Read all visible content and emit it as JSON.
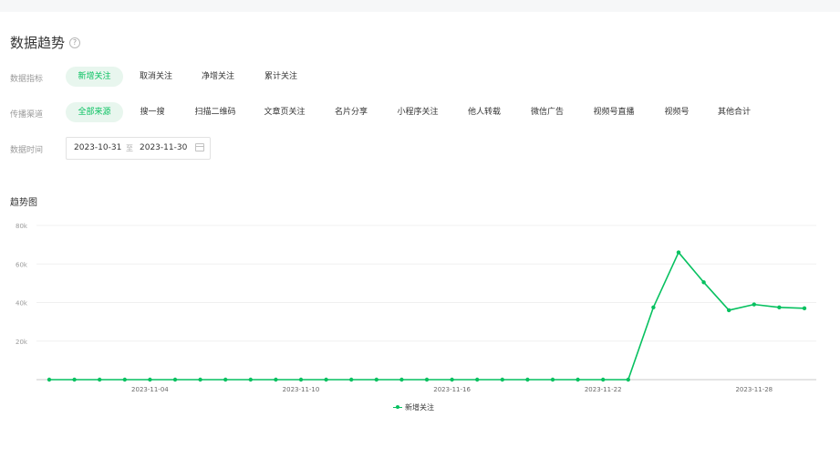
{
  "page": {
    "title": "数据趋势",
    "help_icon": "question-circle-icon"
  },
  "metric_row": {
    "label": "数据指标",
    "options": [
      "新增关注",
      "取消关注",
      "净增关注",
      "累计关注"
    ],
    "selected": "新增关注"
  },
  "source_row": {
    "label": "传播渠道",
    "options": [
      "全部来源",
      "搜一搜",
      "扫描二维码",
      "文章页关注",
      "名片分享",
      "小程序关注",
      "他人转载",
      "微信广告",
      "视频号直播",
      "视频号",
      "其他合计"
    ],
    "selected": "全部来源"
  },
  "time_row": {
    "label": "数据时间",
    "start": "2023-10-31",
    "separator": "至",
    "end": "2023-11-30",
    "icon": "calendar-icon"
  },
  "trend": {
    "title": "趋势图"
  },
  "colors": {
    "accent": "#07c160",
    "accent_bg": "#e8f6ee"
  },
  "chart_data": {
    "type": "line",
    "x": [
      "2023-11-01",
      "2023-11-02",
      "2023-11-03",
      "2023-11-04",
      "2023-11-05",
      "2023-11-06",
      "2023-11-07",
      "2023-11-08",
      "2023-11-09",
      "2023-11-10",
      "2023-11-11",
      "2023-11-12",
      "2023-11-13",
      "2023-11-14",
      "2023-11-15",
      "2023-11-16",
      "2023-11-17",
      "2023-11-18",
      "2023-11-19",
      "2023-11-20",
      "2023-11-21",
      "2023-11-22",
      "2023-11-23",
      "2023-11-24",
      "2023-11-25",
      "2023-11-26",
      "2023-11-27",
      "2023-11-28",
      "2023-11-29",
      "2023-11-30"
    ],
    "x_tick_labels": [
      "2023-11-04",
      "2023-11-10",
      "2023-11-16",
      "2023-11-22",
      "2023-11-28"
    ],
    "series": [
      {
        "name": "新增关注",
        "values": [
          0,
          0,
          0,
          0,
          0,
          0,
          0,
          0,
          0,
          0,
          0,
          0,
          0,
          0,
          0,
          0,
          0,
          0,
          0,
          0,
          0,
          0,
          0,
          0,
          37500,
          66000,
          50500,
          36000,
          39000,
          37500,
          37000
        ]
      }
    ],
    "y_ticks": [
      "20k",
      "40k",
      "60k",
      "80k"
    ],
    "ylim": [
      0,
      80000
    ],
    "grid": true,
    "legend_position": "bottom-center"
  }
}
